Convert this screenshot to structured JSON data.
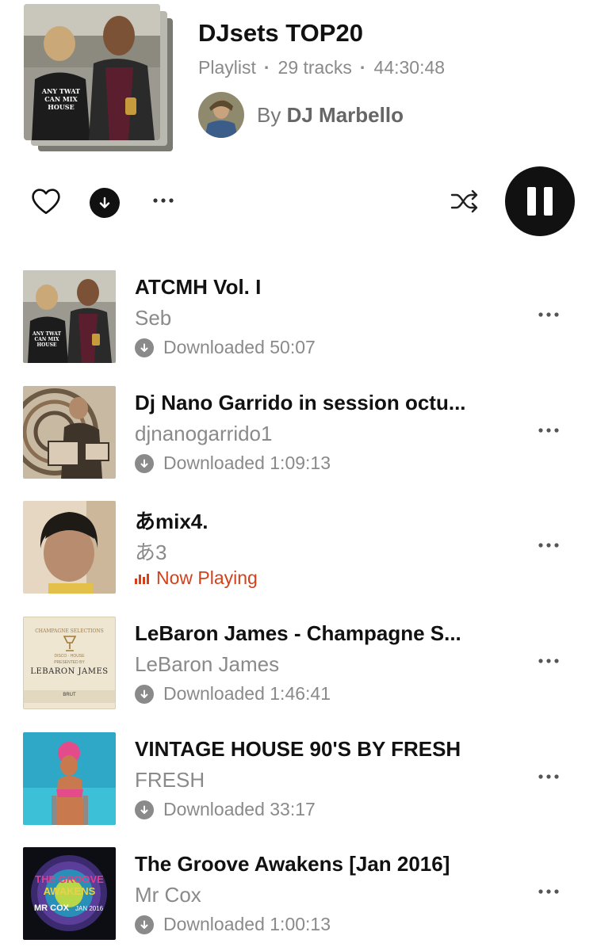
{
  "playlist": {
    "title": "DJsets TOP20",
    "type_label": "Playlist",
    "track_count": "29 tracks",
    "duration": "44:30:48",
    "by_label": "By",
    "owner": "DJ Marbello",
    "cover_text": [
      "ANY TWAT",
      "CAN MIX",
      "HOUSE"
    ]
  },
  "actions": {
    "like_icon": "heart-icon",
    "download_icon": "download-icon",
    "more_icon": "more-icon",
    "shuffle_icon": "shuffle-icon",
    "pause_icon": "pause-icon"
  },
  "colors": {
    "accent_playing": "#d4401a",
    "primary_text": "#111111",
    "secondary_text": "#8a8a8a"
  },
  "tracks": [
    {
      "title": "ATCMH Vol. I",
      "artist": "Seb",
      "status": "Downloaded",
      "duration": "50:07"
    },
    {
      "title": "Dj Nano Garrido in session octu...",
      "artist": "djnanogarrido1",
      "status": "Downloaded",
      "duration": "1:09:13"
    },
    {
      "title": "あmix4.",
      "artist": "あ3",
      "status": "Now Playing",
      "duration": ""
    },
    {
      "title": "LeBaron James - Champagne S...",
      "artist": "LeBaron James",
      "status": "Downloaded",
      "duration": "1:46:41",
      "art_text": [
        "CHAMPAGNE SELECTIONS",
        "DISCO · HOUSE",
        "PRESENTED BY",
        "LEBARON JAMES",
        "BRUT"
      ]
    },
    {
      "title": "VINTAGE HOUSE 90'S BY FRESH",
      "artist": "FRESH",
      "status": "Downloaded",
      "duration": "33:17"
    },
    {
      "title": "The Groove Awakens [Jan 2016]",
      "artist": "Mr Cox",
      "status": "Downloaded",
      "duration": "1:00:13",
      "art_text": [
        "THE GROOVE",
        "AWAKENS",
        "MR COX",
        "JAN 2016"
      ]
    }
  ]
}
